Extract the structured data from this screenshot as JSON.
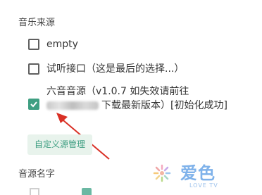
{
  "sections": {
    "source_title": "音乐来源",
    "name_title": "音源名字"
  },
  "options": [
    {
      "label": "empty",
      "checked": false
    },
    {
      "label": "试听接口（这是最后的选择...）",
      "checked": false
    },
    {
      "label_line1": "六音音源（v1.0.7 如失效请前往",
      "label_line2": "下载最新版本）[初始化成功]",
      "checked": true
    }
  ],
  "buttons": {
    "custom_source": "自定义源管理"
  },
  "watermark": {
    "title": "爱色",
    "subtitle": "LOVE TV"
  },
  "colors": {
    "accent": "#3f9f82",
    "arrow": "#d93025"
  }
}
